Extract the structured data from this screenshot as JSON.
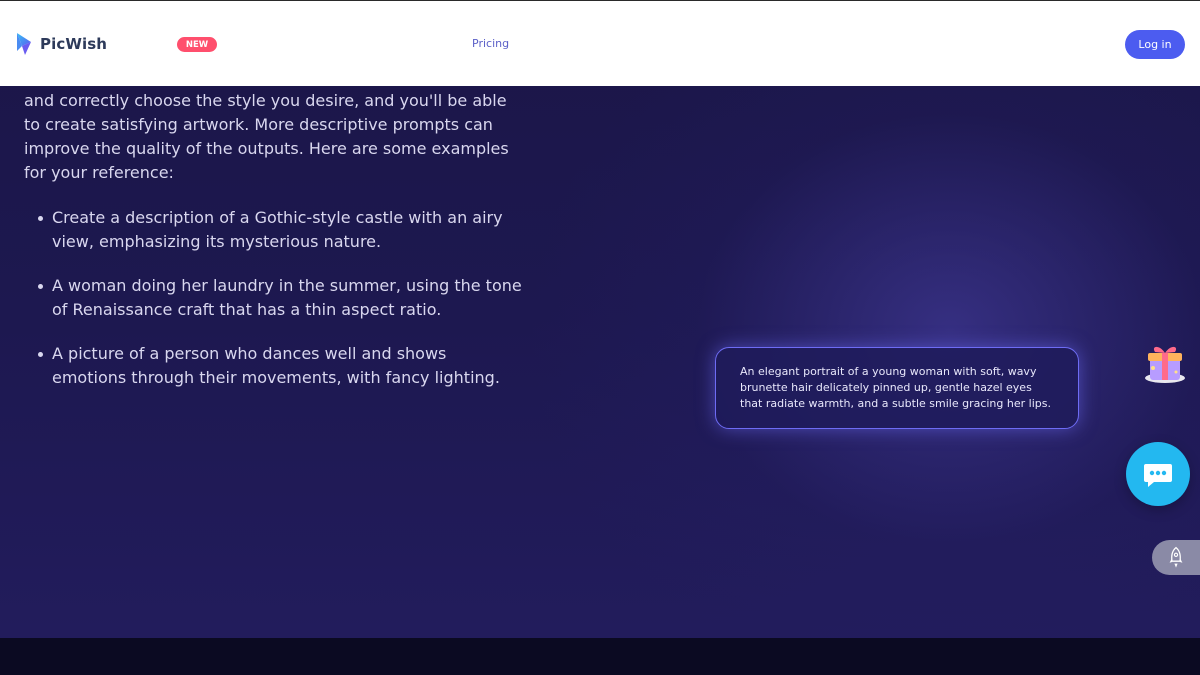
{
  "header": {
    "brand": "PicWish",
    "new_badge": "NEW",
    "nav": {
      "pricing": "Pricing"
    },
    "login_label": "Log in"
  },
  "content": {
    "intro": "and correctly choose the style you desire, and you'll be able to create satisfying artwork. More descriptive prompts can improve the quality of the outputs. Here are some examples for your reference:",
    "examples": [
      "Create a description of a Gothic-style castle with an airy view, emphasizing its mysterious nature.",
      "A woman doing her laundry in the summer, using the tone of Renaissance craft that has a thin aspect ratio.",
      "A picture of a person who dances well and shows emotions through their movements, with fancy lighting."
    ]
  },
  "prompt_card": {
    "text": "An elegant portrait of a young woman with soft, wavy brunette hair delicately pinned up, gentle hazel eyes that radiate warmth, and a subtle smile gracing her lips."
  },
  "widgets": {
    "gift_icon": "gift-box-icon",
    "chat_icon": "chat-bubble-icon",
    "rocket_icon": "rocket-icon"
  },
  "colors": {
    "brand_accent": "#4c5cf0",
    "badge": "#ff4f6d",
    "chat": "#23b8f0",
    "background": "#1b1648"
  }
}
